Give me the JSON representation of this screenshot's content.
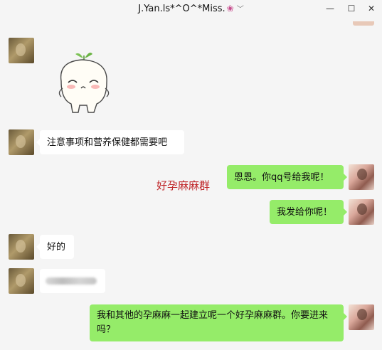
{
  "window": {
    "title": "J.Yan.ls*^O^*Miss.",
    "title_icon": "flower-icon",
    "dropdown_icon": "chevron-down-icon"
  },
  "controls": {
    "minimize": "—",
    "maximize": "☐",
    "close": "✕"
  },
  "messages": [
    {
      "side": "left",
      "type": "sticker",
      "sticker_name": "sprout-bun-sticker"
    },
    {
      "side": "left",
      "type": "text",
      "text": "注意事项和营养保健都需要吧"
    },
    {
      "side": "right",
      "type": "text",
      "text": "恩恩。你qq号给我呢！"
    },
    {
      "side": "right",
      "type": "text",
      "text": "我发给你呢！"
    },
    {
      "side": "left",
      "type": "text",
      "text": "好的"
    },
    {
      "side": "left",
      "type": "blurred",
      "text": ""
    },
    {
      "side": "right",
      "type": "text",
      "text": "我和其他的孕麻麻一起建立呢一个好孕麻麻群。你要进来吗？"
    }
  ],
  "overlay": {
    "watermark": "好孕麻麻群"
  },
  "colors": {
    "background": "#f5f5f5",
    "incoming_bubble": "#ffffff",
    "outgoing_bubble": "#95ec69",
    "watermark": "#c0282b"
  }
}
